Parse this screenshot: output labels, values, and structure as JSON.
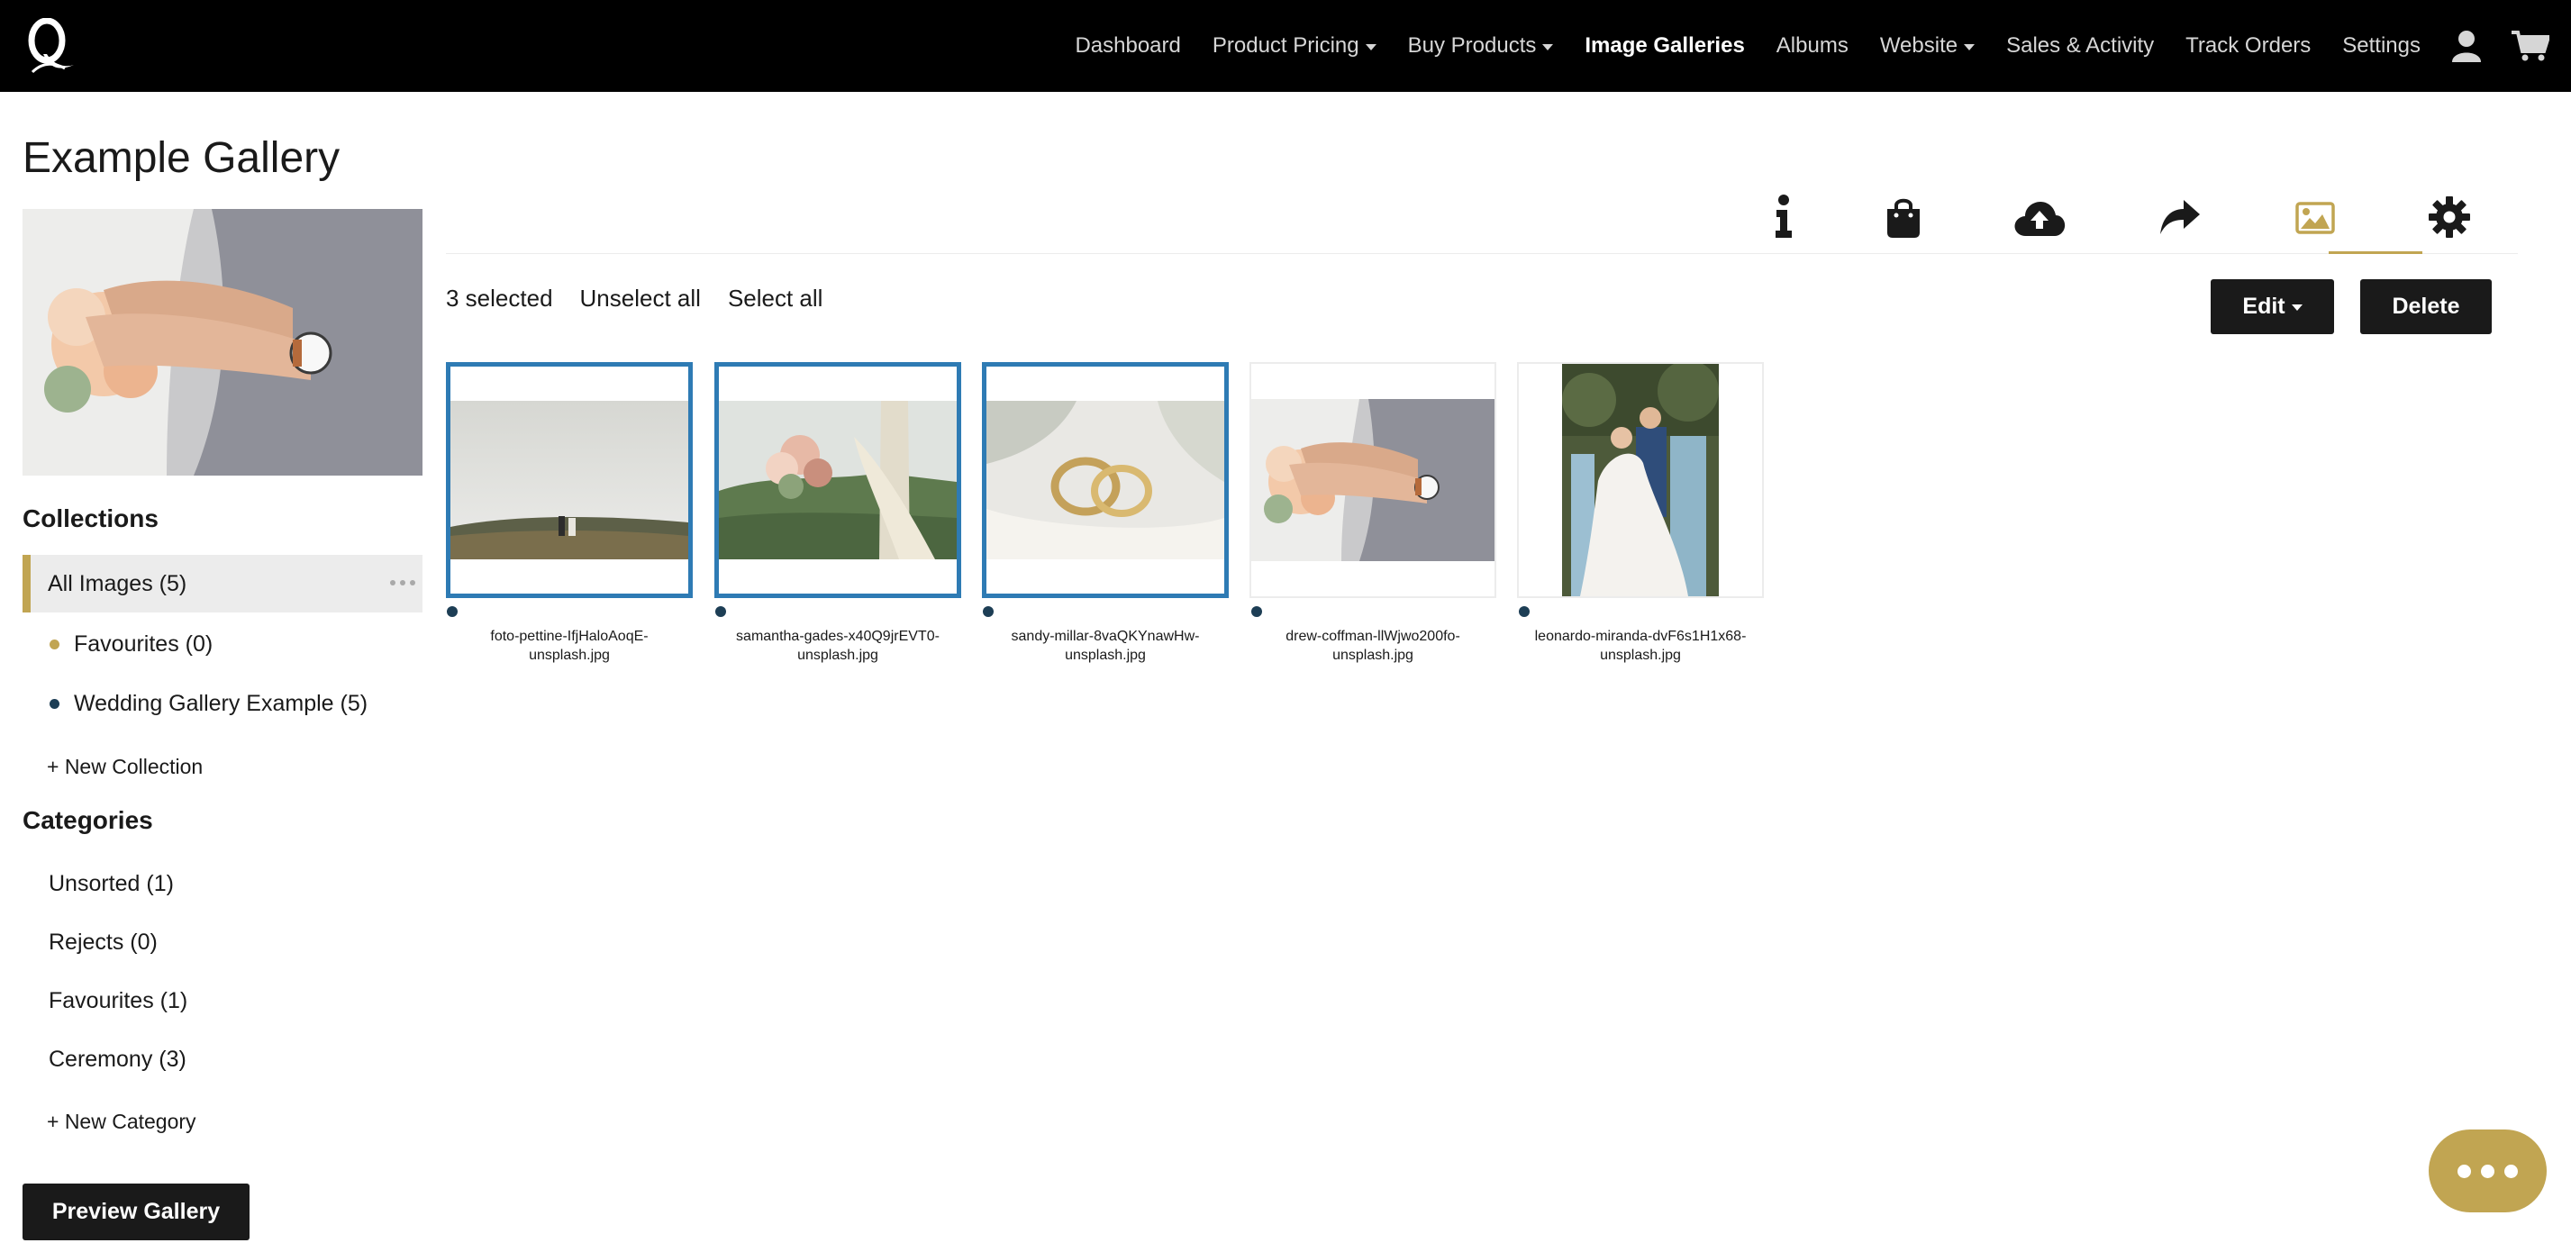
{
  "brand": {
    "accent": "#c1a552",
    "selected_border": "#2e7bb4",
    "nav_bg": "#000000"
  },
  "nav": {
    "items": [
      {
        "label": "Dashboard",
        "dropdown": false,
        "active": false
      },
      {
        "label": "Product Pricing",
        "dropdown": true,
        "active": false
      },
      {
        "label": "Buy Products",
        "dropdown": true,
        "active": false
      },
      {
        "label": "Image Galleries",
        "dropdown": false,
        "active": true
      },
      {
        "label": "Albums",
        "dropdown": false,
        "active": false
      },
      {
        "label": "Website",
        "dropdown": true,
        "active": false
      },
      {
        "label": "Sales & Activity",
        "dropdown": false,
        "active": false
      },
      {
        "label": "Track Orders",
        "dropdown": false,
        "active": false
      },
      {
        "label": "Settings",
        "dropdown": false,
        "active": false
      }
    ],
    "icons": [
      "user-icon",
      "cart-icon"
    ]
  },
  "page": {
    "title": "Example Gallery"
  },
  "sidebar": {
    "collections_heading": "Collections",
    "collections": [
      {
        "label": "All Images (5)",
        "active": true,
        "dot_color": ""
      },
      {
        "label": "Favourites (0)",
        "active": false,
        "dot_color": "#c1a552"
      },
      {
        "label": "Wedding Gallery Example (5)",
        "active": false,
        "dot_color": "#1d3e55"
      }
    ],
    "new_collection": "+ New Collection",
    "categories_heading": "Categories",
    "categories": [
      {
        "label": "Unsorted (1)"
      },
      {
        "label": "Rejects (0)"
      },
      {
        "label": "Favourites (1)"
      },
      {
        "label": "Ceremony (3)"
      }
    ],
    "new_category": "+ New Category",
    "preview_button": "Preview Gallery"
  },
  "tools": [
    "info-icon",
    "shopping-bag-icon",
    "cloud-upload-icon",
    "share-icon",
    "image-icon",
    "gear-icon"
  ],
  "selection": {
    "count_text": "3 selected",
    "unselect_all": "Unselect all",
    "select_all": "Select all",
    "edit_label": "Edit",
    "delete_label": "Delete"
  },
  "images": [
    {
      "name_line1": "foto-pettine-IfjHaloAoqE-",
      "name_line2": "unsplash.jpg",
      "selected": true
    },
    {
      "name_line1": "samantha-gades-x40Q9jrEVT0-",
      "name_line2": "unsplash.jpg",
      "selected": true
    },
    {
      "name_line1": "sandy-millar-8vaQKYnawHw-",
      "name_line2": "unsplash.jpg",
      "selected": true
    },
    {
      "name_line1": "drew-coffman-llWjwo200fo-",
      "name_line2": "unsplash.jpg",
      "selected": false
    },
    {
      "name_line1": "leonardo-miranda-dvF6s1H1x68-",
      "name_line2": "unsplash.jpg",
      "selected": false
    }
  ]
}
